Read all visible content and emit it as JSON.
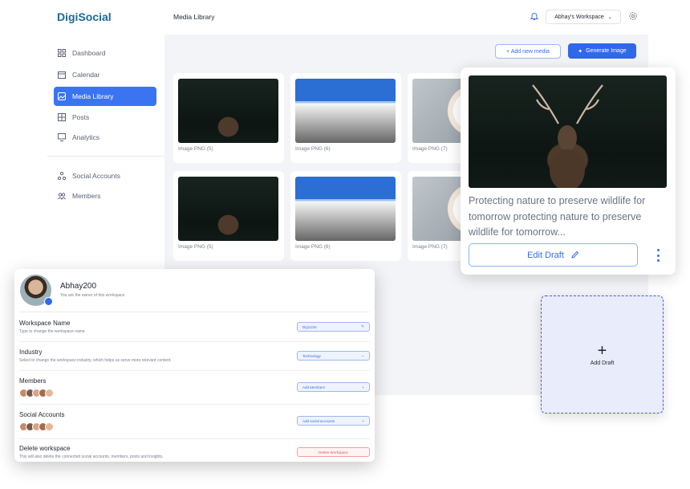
{
  "app": {
    "logo": "DigiSocial",
    "page_title": "Media Library",
    "workspace": "Abhay's Workspace"
  },
  "sidebar": {
    "items": [
      {
        "label": "Dashboard",
        "icon": "dashboard-icon"
      },
      {
        "label": "Calendar",
        "icon": "calendar-icon"
      },
      {
        "label": "Media Library",
        "icon": "image-icon",
        "active": true
      },
      {
        "label": "Posts",
        "icon": "grid-icon"
      },
      {
        "label": "Analytics",
        "icon": "analytics-icon"
      },
      {
        "label": "Social Accounts",
        "icon": "share-icon"
      },
      {
        "label": "Members",
        "icon": "members-icon"
      }
    ]
  },
  "toolbar": {
    "add_media": "+ Add new media",
    "generate": "Generate Image"
  },
  "media": [
    {
      "label": "Image PNG (5)",
      "kind": "deer"
    },
    {
      "label": "Image PNG (6)",
      "kind": "street"
    },
    {
      "label": "Image PNG (7)",
      "kind": "food"
    },
    {
      "label": "Image PNG (5)",
      "kind": "deer"
    },
    {
      "label": "Image PNG (6)",
      "kind": "street"
    },
    {
      "label": "Image PNG (7)",
      "kind": "food"
    }
  ],
  "post_card": {
    "text": "Protecting nature to preserve wildlife for tomorrow protecting nature to preserve wildlife for tomorrow...",
    "edit_label": "Edit Draft"
  },
  "add_draft": {
    "label": "Add Draft"
  },
  "settings": {
    "user_name": "Abhay200",
    "user_sub": "You are the owner of this workspace",
    "workspace_name": {
      "title": "Workspace Name",
      "sub": "Type to change the workspace name",
      "value": "Digi1234"
    },
    "industry": {
      "title": "Industry",
      "sub": "Select to change the workspace industry, which helps us serve more relevant content.",
      "value": "Technology"
    },
    "members": {
      "title": "Members",
      "action": "Add Members"
    },
    "social_accounts": {
      "title": "Social Accounts",
      "action": "Add social accounts"
    },
    "delete": {
      "title": "Delete workspace",
      "sub": "This will also delete the connected social accounts, members, posts and insights.",
      "action": "Delete Workspace"
    }
  },
  "colors": {
    "accent": "#2f69e9",
    "brand": "#1b6a95",
    "danger": "#e05252"
  }
}
